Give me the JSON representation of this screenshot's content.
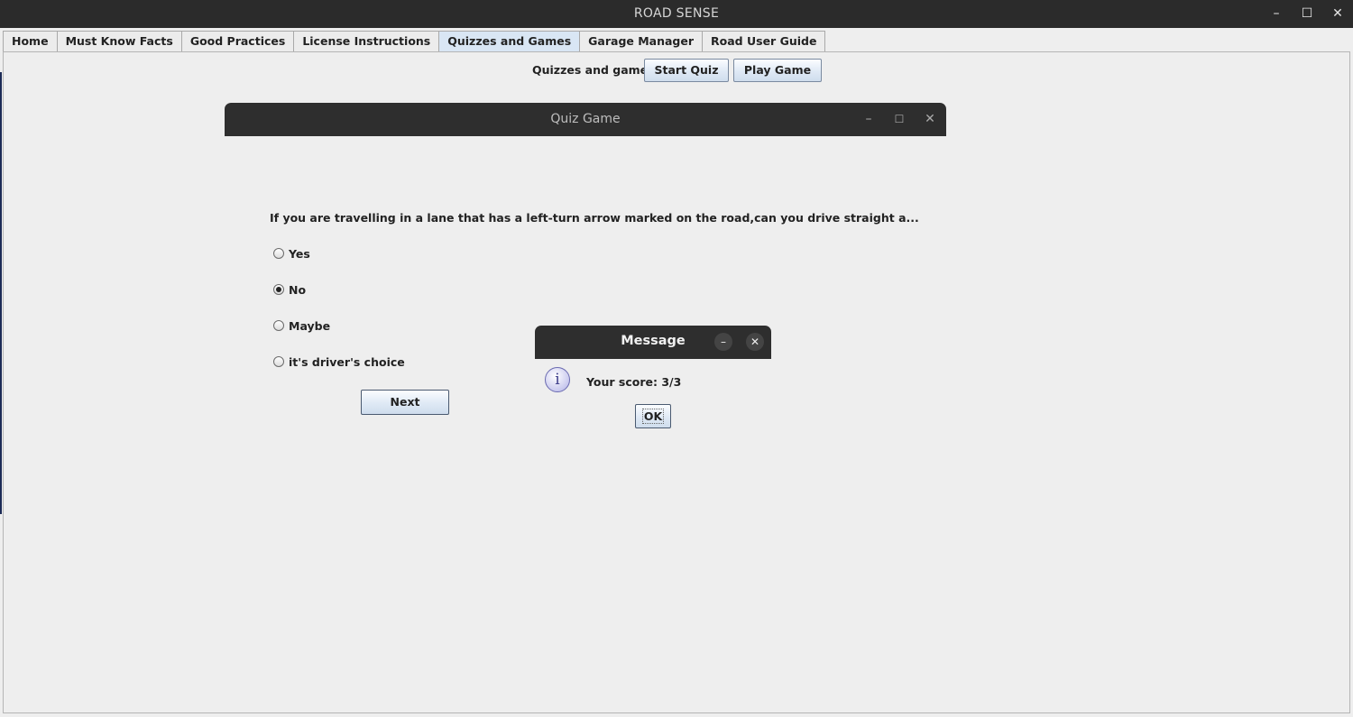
{
  "app": {
    "title": "ROAD SENSE"
  },
  "window_controls": {
    "minimize": "–",
    "maximize": "☐",
    "close": "✕"
  },
  "tabs": [
    {
      "label": "Home",
      "active": false
    },
    {
      "label": "Must Know Facts",
      "active": false
    },
    {
      "label": "Good Practices",
      "active": false
    },
    {
      "label": "License Instructions",
      "active": false
    },
    {
      "label": "Quizzes and Games",
      "active": true
    },
    {
      "label": "Garage Manager",
      "active": false
    },
    {
      "label": "Road User Guide",
      "active": false
    }
  ],
  "toolbar": {
    "label": "Quizzes and games:",
    "start_quiz": "Start Quiz",
    "play_game": "Play Game"
  },
  "quiz_window": {
    "title": "Quiz Game",
    "question": "If you are travelling in a lane that has a left-turn arrow marked on the road,can you drive straight a...",
    "options": [
      {
        "label": "Yes",
        "selected": false
      },
      {
        "label": "No",
        "selected": true
      },
      {
        "label": "Maybe",
        "selected": false
      },
      {
        "label": "it's driver's choice",
        "selected": false
      }
    ],
    "next_label": "Next"
  },
  "message_dialog": {
    "title": "Message",
    "icon": "info-icon",
    "icon_glyph": "i",
    "text": "Your score: 3/3",
    "ok_label": "OK"
  },
  "colors": {
    "titlebar": "#2b2b2b",
    "background": "#eeeeee",
    "active_tab": "#d9e6f4"
  }
}
